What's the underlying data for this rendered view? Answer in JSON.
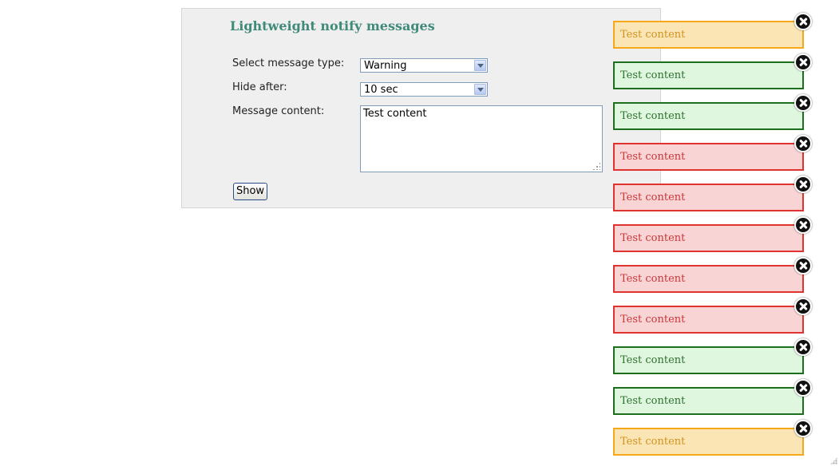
{
  "panel": {
    "title": "Lightweight notify messages",
    "form": {
      "type_label": "Select message type:",
      "type_value": "Warning",
      "hide_label": "Hide after:",
      "hide_value": "10 sec",
      "content_label": "Message content:",
      "content_value": "Test content",
      "show_button": "Show"
    }
  },
  "notifications": [
    {
      "type": "warning",
      "text": "Test content"
    },
    {
      "type": "success",
      "text": "Test content"
    },
    {
      "type": "success",
      "text": "Test content"
    },
    {
      "type": "error",
      "text": "Test content"
    },
    {
      "type": "error",
      "text": "Test content"
    },
    {
      "type": "error",
      "text": "Test content"
    },
    {
      "type": "error",
      "text": "Test content"
    },
    {
      "type": "error",
      "text": "Test content"
    },
    {
      "type": "success",
      "text": "Test content"
    },
    {
      "type": "success",
      "text": "Test content"
    },
    {
      "type": "warning",
      "text": "Test content"
    }
  ],
  "colors": {
    "title": "#3f8a78",
    "warning_bg": "#fce5b4",
    "warning_border": "#f4a81a",
    "success_bg": "#dff7df",
    "success_border": "#1d6e1d",
    "error_bg": "#f9d4d4",
    "error_border": "#e0322f"
  },
  "icons": {
    "close": "close-icon",
    "select_arrow": "chevron-down-icon",
    "resize": "resize-grip-icon"
  }
}
